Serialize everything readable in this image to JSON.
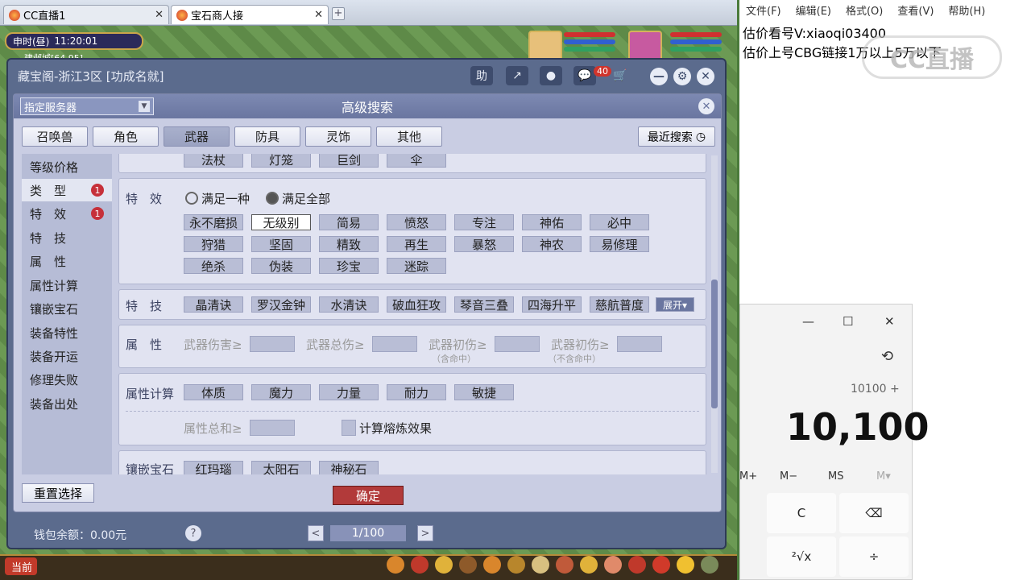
{
  "browser": {
    "tabs": [
      {
        "label": "CC直播1",
        "close": "✕"
      },
      {
        "label": "宝石商人接",
        "close": "✕"
      }
    ],
    "new_tab": "+"
  },
  "game": {
    "clock": {
      "period": "申时(昼)",
      "time": "11:20:01"
    },
    "location": "建邺城[64,95]",
    "bottom_bar_label": "当前"
  },
  "window": {
    "title": "藏宝阁-浙江3区 [功成名就]",
    "buttons": {
      "help": "助",
      "share": "↗",
      "record": "●",
      "chat_badge": "40",
      "cart": "🛒",
      "minimize": "—",
      "settings": "⚙",
      "close": "✕"
    },
    "wallet": "钱包余额：0.00元",
    "help_icon": "?",
    "pager": {
      "prev": "<",
      "page": "1/100",
      "next": ">"
    }
  },
  "dialog": {
    "title": "高级搜索",
    "server_select": "指定服务器",
    "close": "✕",
    "category_tabs": [
      "召唤兽",
      "角色",
      "武器",
      "防具",
      "灵饰",
      "其他"
    ],
    "selected_tab": "武器",
    "recent_search": "最近搜索",
    "left_nav": [
      {
        "label": "等级价格",
        "badge": ""
      },
      {
        "label": "类　型",
        "badge": "1"
      },
      {
        "label": "特　效",
        "badge": "1"
      },
      {
        "label": "特　技",
        "badge": ""
      },
      {
        "label": "属　性",
        "badge": ""
      },
      {
        "label": "属性计算",
        "badge": ""
      },
      {
        "label": "镶嵌宝石",
        "badge": ""
      },
      {
        "label": "装备特性",
        "badge": ""
      },
      {
        "label": "装备开运",
        "badge": ""
      },
      {
        "label": "修理失败",
        "badge": ""
      },
      {
        "label": "装备出处",
        "badge": ""
      }
    ],
    "type_row_partial": [
      "法杖",
      "灯笼",
      "巨剑",
      "伞"
    ],
    "effects": {
      "label": "特　效",
      "radio_any": "满足一种",
      "radio_all": "满足全部",
      "chips": [
        "永不磨损",
        "无级别",
        "简易",
        "愤怒",
        "专注",
        "神佑",
        "必中",
        "狩猎",
        "坚固",
        "精致",
        "再生",
        "暴怒",
        "神农",
        "易修理",
        "绝杀",
        "伪装",
        "珍宝",
        "迷踪"
      ],
      "selected": "无级别"
    },
    "skills": {
      "label": "特　技",
      "chips": [
        "晶清诀",
        "罗汉金钟",
        "水清诀",
        "破血狂攻",
        "琴音三叠",
        "四海升平",
        "慈航普度"
      ],
      "expand": "展开▾"
    },
    "attributes": {
      "label": "属　性",
      "fields": [
        {
          "label": "武器伤害≥",
          "sub": ""
        },
        {
          "label": "武器总伤≥",
          "sub": ""
        },
        {
          "label": "武器初伤≥",
          "sub": "（含命中）"
        },
        {
          "label": "武器初伤≥",
          "sub": "（不含命中）"
        }
      ]
    },
    "attr_calc": {
      "label": "属性计算",
      "chips": [
        "体质",
        "魔力",
        "力量",
        "耐力",
        "敏捷"
      ],
      "sum_label": "属性总和≥",
      "refine_label": "计算熔炼效果"
    },
    "gems": {
      "label": "镶嵌宝石",
      "chips": [
        "红玛瑙",
        "太阳石",
        "神秘石"
      ]
    },
    "reset": "重置选择",
    "confirm": "确定"
  },
  "notepad": {
    "menu": [
      "文件(F)",
      "编辑(E)",
      "格式(O)",
      "查看(V)",
      "帮助(H)"
    ],
    "lines": [
      "估价看号V:xiaoqi03400",
      "估价上号CBG链接1万以上5万以下"
    ],
    "watermark": "CC直播"
  },
  "calculator": {
    "controls": {
      "minimize": "—",
      "maximize": "☐",
      "close": "✕"
    },
    "history_icon": "⟲",
    "expression": "10100 +",
    "display": "10,100",
    "memory_keys": [
      "M+",
      "M−",
      "MS",
      "M▾"
    ],
    "keys_row1": [
      "C",
      "⌫"
    ],
    "keys_row2": [
      "²√x",
      "÷"
    ]
  }
}
